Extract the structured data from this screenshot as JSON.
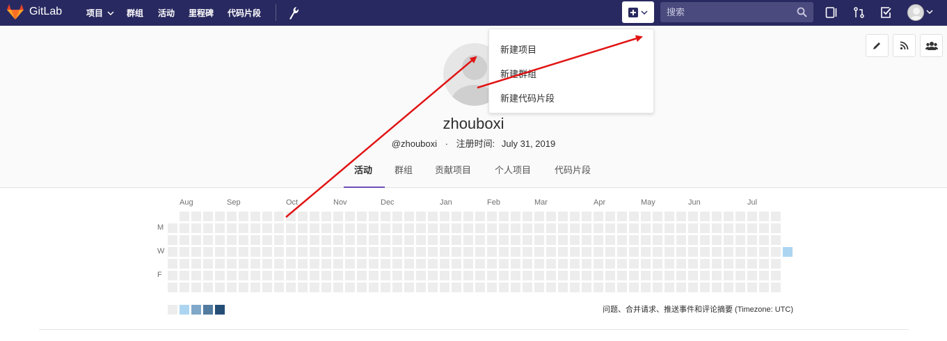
{
  "navbar": {
    "brand": "GitLab",
    "links": [
      "项目",
      "群组",
      "活动",
      "里程碑",
      "代码片段"
    ],
    "search_placeholder": "搜索"
  },
  "profile": {
    "name": "zhouboxi",
    "handle": "@zhouboxi",
    "separator": "·",
    "joined_label": "注册时间:",
    "joined_date": "July 31, 2019"
  },
  "tabs": [
    "活动",
    "群组",
    "贡献项目",
    "个人项目",
    "代码片段"
  ],
  "active_tab": "活动",
  "dropdown": {
    "items": [
      "新建项目",
      "新建群组",
      "新建代码片段"
    ]
  },
  "calendar": {
    "months": [
      "Aug",
      "Sep",
      "Oct",
      "Nov",
      "Dec",
      "Jan",
      "Feb",
      "Mar",
      "Apr",
      "May",
      "Jun",
      "Jul"
    ],
    "day_labels": [
      "M",
      "W",
      "F"
    ],
    "legend_text": "问题、合并请求、推送事件和评论摘要 (Timezone: UTC)",
    "legend_colors": [
      "#ededed",
      "#acd5f2",
      "#7fa8c9",
      "#527ba0",
      "#254e77"
    ],
    "empty_color": "#ededed",
    "active_color": "#acd5f2"
  },
  "colors": {
    "navbar": "#292961",
    "accent": "#6b4fbb",
    "arrow": "#e11414"
  }
}
